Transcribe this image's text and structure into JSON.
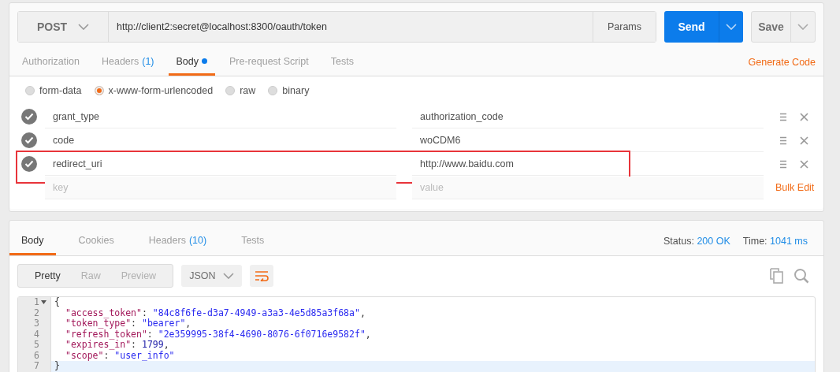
{
  "request": {
    "method": "POST",
    "url": "http://client2:secret@localhost:8300/oauth/token",
    "params_button": "Params",
    "send_button": "Send",
    "save_button": "Save"
  },
  "request_tabs": [
    {
      "label": "Authorization",
      "selected": false,
      "dot": false
    },
    {
      "label": "Headers",
      "count": "(1)",
      "selected": false,
      "dot": false
    },
    {
      "label": "Body",
      "selected": true,
      "dot": true
    },
    {
      "label": "Pre-request Script",
      "selected": false,
      "dot": false
    },
    {
      "label": "Tests",
      "selected": false,
      "dot": false
    }
  ],
  "generate_code": "Generate Code",
  "body_types": [
    {
      "label": "form-data",
      "selected": false
    },
    {
      "label": "x-www-form-urlencoded",
      "selected": true
    },
    {
      "label": "raw",
      "selected": false
    },
    {
      "label": "binary",
      "selected": false
    }
  ],
  "params": [
    {
      "key": "grant_type",
      "value": "authorization_code",
      "checked": true,
      "highlighted": false
    },
    {
      "key": "code",
      "value": "woCDM6",
      "checked": true,
      "highlighted": false
    },
    {
      "key": "redirect_uri",
      "value": "http://www.baidu.com",
      "checked": true,
      "highlighted": true
    }
  ],
  "new_param": {
    "key_placeholder": "key",
    "value_placeholder": "value"
  },
  "bulk_edit": "Bulk Edit",
  "response_tabs": [
    {
      "label": "Body",
      "selected": true
    },
    {
      "label": "Cookies",
      "selected": false
    },
    {
      "label": "Headers",
      "count": "(10)",
      "selected": false
    },
    {
      "label": "Tests",
      "selected": false
    }
  ],
  "status": {
    "label": "Status:",
    "value": "200 OK"
  },
  "time": {
    "label": "Time:",
    "value": "1041 ms"
  },
  "view_modes": [
    {
      "label": "Pretty",
      "selected": true
    },
    {
      "label": "Raw",
      "selected": false
    },
    {
      "label": "Preview",
      "selected": false
    }
  ],
  "format": "JSON",
  "code_lines": [
    {
      "number": "1",
      "fold": true,
      "active": false,
      "tokens": [
        {
          "kind": "punct",
          "text": "{"
        }
      ]
    },
    {
      "number": "2",
      "fold": false,
      "active": false,
      "tokens": [
        {
          "kind": "key",
          "text": "\"access_token\""
        },
        {
          "kind": "punct",
          "text": ": "
        },
        {
          "kind": "string",
          "text": "\"84c8f6fe-d3a7-4949-a3a3-4e5d85a3f68a\""
        },
        {
          "kind": "punct",
          "text": ","
        }
      ]
    },
    {
      "number": "3",
      "fold": false,
      "active": false,
      "tokens": [
        {
          "kind": "key",
          "text": "\"token_type\""
        },
        {
          "kind": "punct",
          "text": ": "
        },
        {
          "kind": "string",
          "text": "\"bearer\""
        },
        {
          "kind": "punct",
          "text": ","
        }
      ]
    },
    {
      "number": "4",
      "fold": false,
      "active": false,
      "tokens": [
        {
          "kind": "key",
          "text": "\"refresh_token\""
        },
        {
          "kind": "punct",
          "text": ": "
        },
        {
          "kind": "string",
          "text": "\"2e359995-38f4-4690-8076-6f0716e9582f\""
        },
        {
          "kind": "punct",
          "text": ","
        }
      ]
    },
    {
      "number": "5",
      "fold": false,
      "active": false,
      "tokens": [
        {
          "kind": "key",
          "text": "\"expires_in\""
        },
        {
          "kind": "punct",
          "text": ": "
        },
        {
          "kind": "number",
          "text": "1799"
        },
        {
          "kind": "punct",
          "text": ","
        }
      ]
    },
    {
      "number": "6",
      "fold": false,
      "active": false,
      "tokens": [
        {
          "kind": "key",
          "text": "\"scope\""
        },
        {
          "kind": "punct",
          "text": ": "
        },
        {
          "kind": "string",
          "text": "\"user_info\""
        }
      ]
    },
    {
      "number": "7",
      "fold": false,
      "active": true,
      "tokens": [
        {
          "kind": "punct",
          "text": "}"
        }
      ]
    }
  ]
}
